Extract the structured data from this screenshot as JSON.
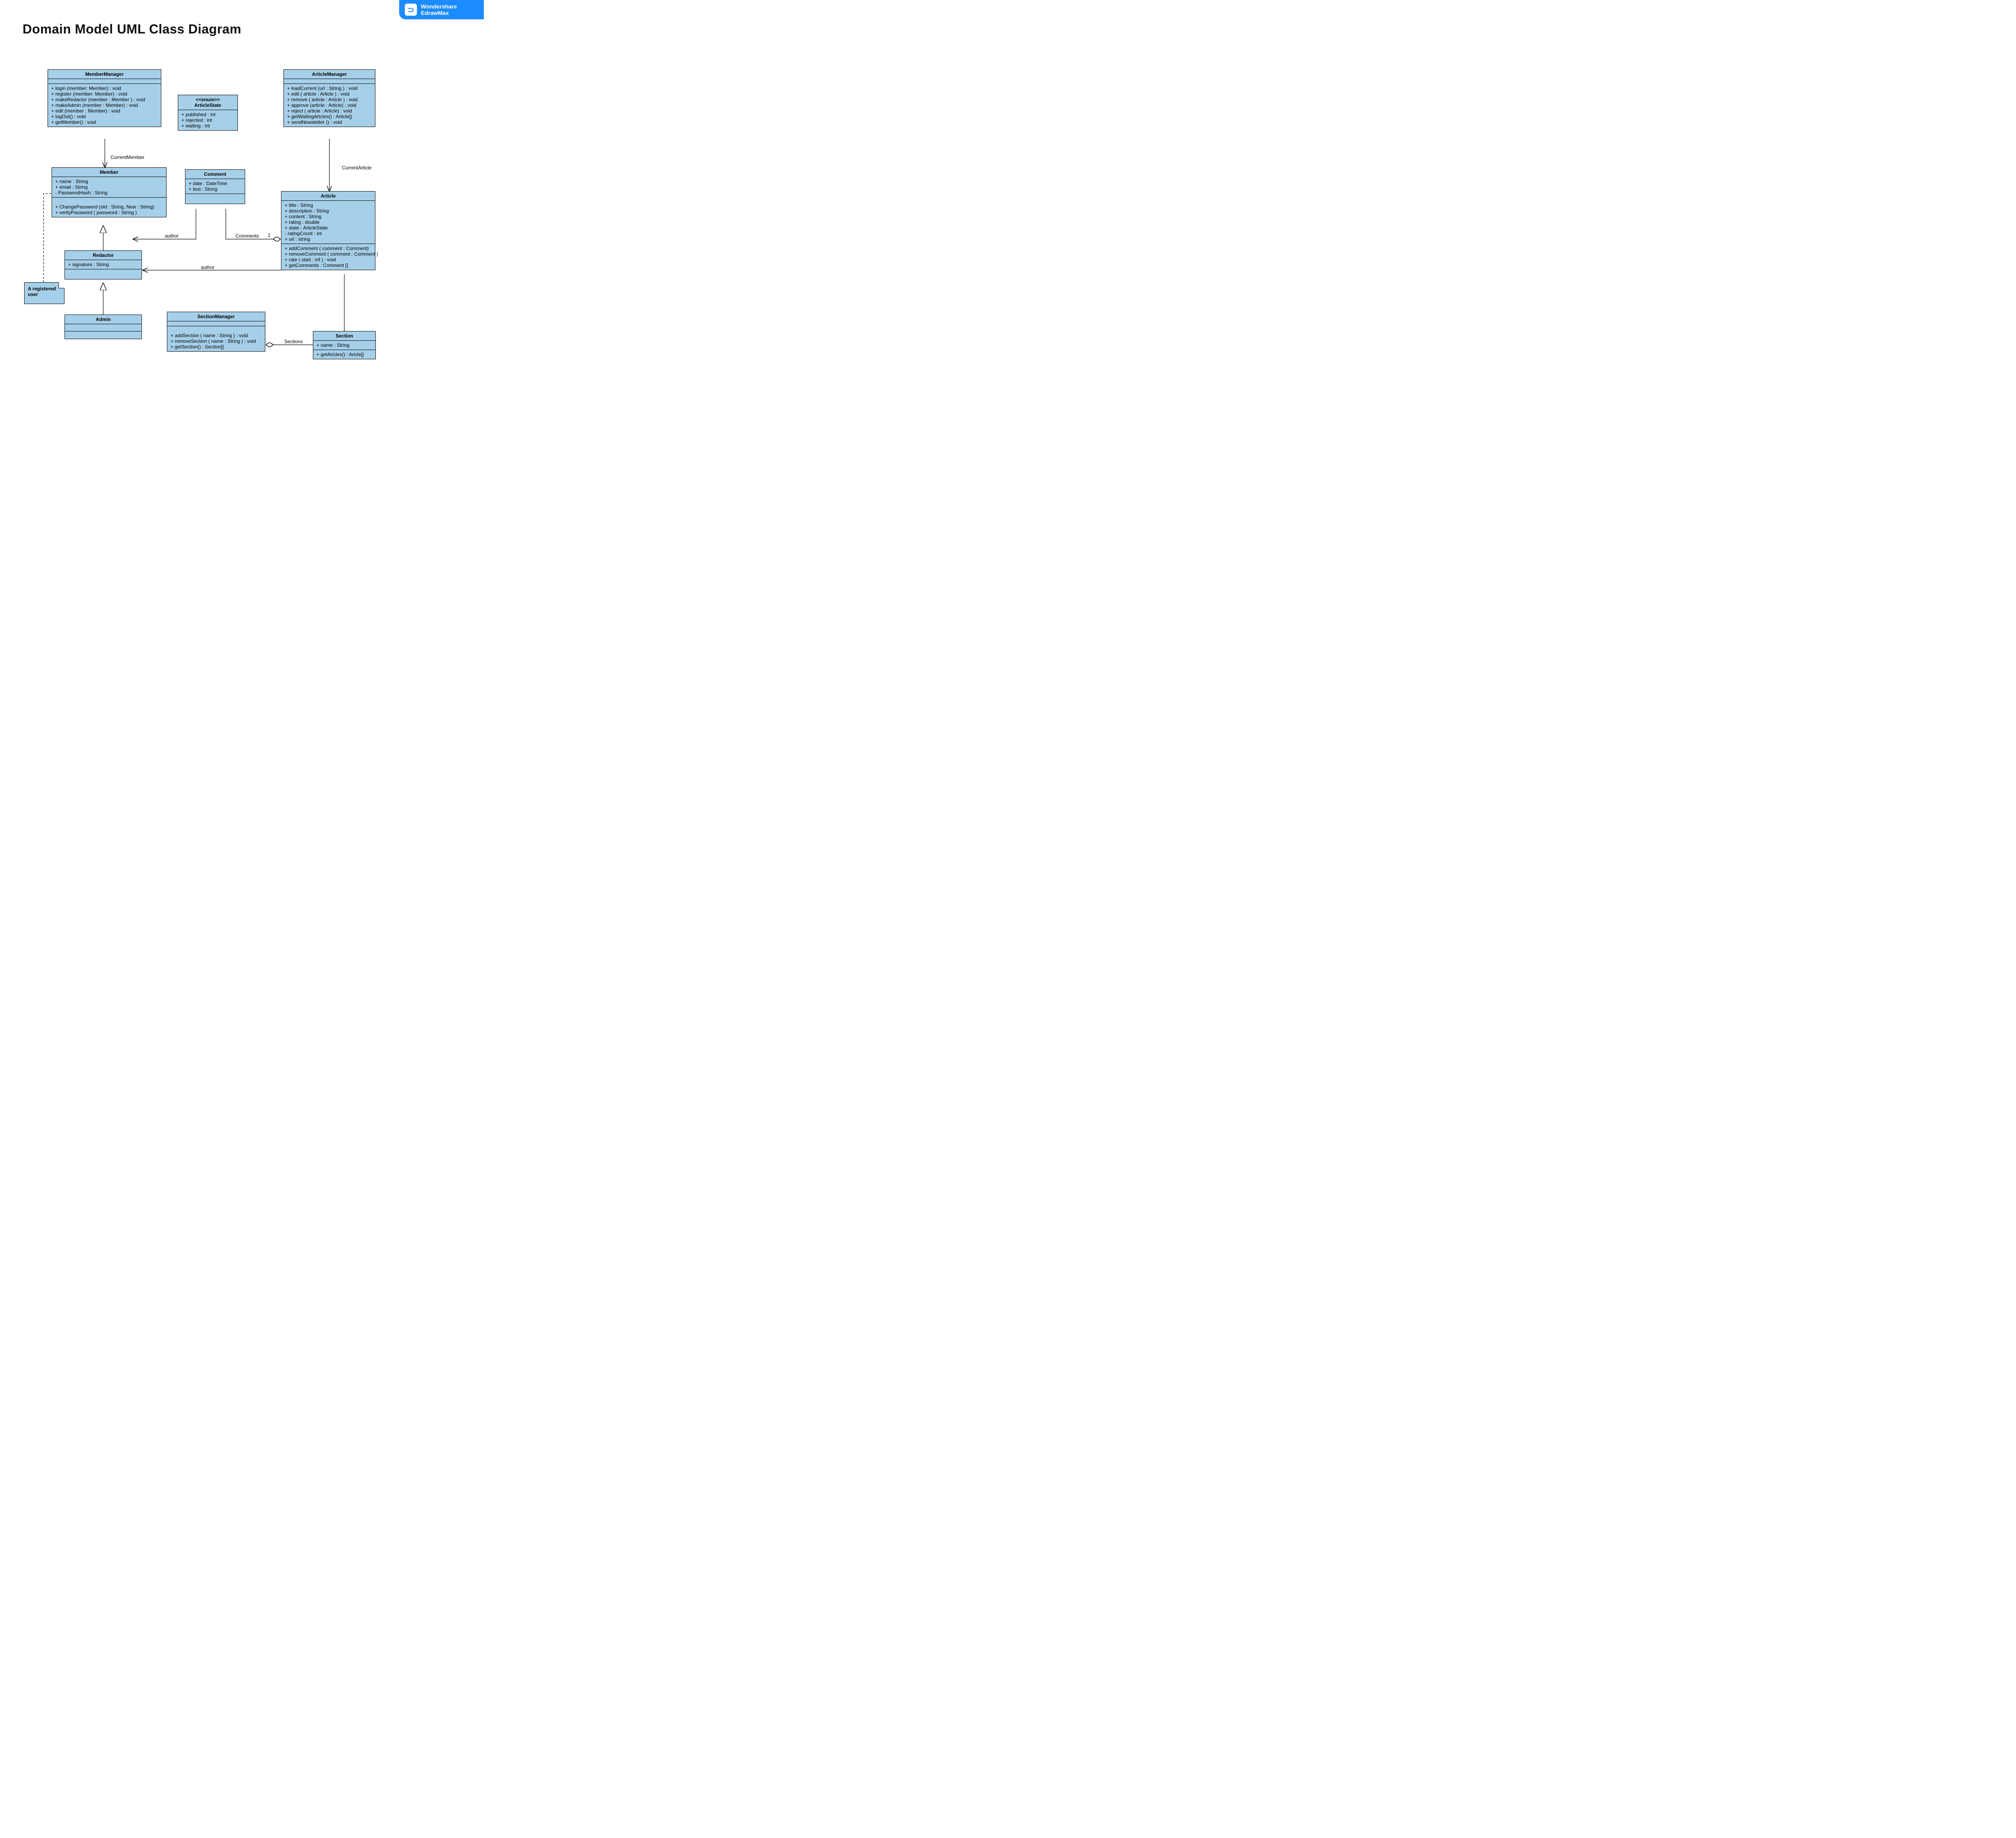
{
  "title": "Domain Model UML Class Diagram",
  "brand": {
    "line1": "Wondershare",
    "line2": "EdrawMax",
    "icon": "⊃"
  },
  "memberManager": {
    "name": "MemberManager",
    "ops": [
      "+  login (member: Member) : void",
      "+  register (member: Member) : void",
      "+ makeRedactor (member : Member ) : void",
      "+ makeAdmin (member : Member) : void",
      "+ edit (member : Member) : void",
      "+ logOut() : void",
      "+ getMember() : void"
    ]
  },
  "member": {
    "name": "Member",
    "attrs": [
      "+ name : String",
      "+ email : String",
      "- PasswordHash : String"
    ],
    "ops": [
      "+  ChangePassword (old : String, New : String)",
      "+  verityPassword ( password : String )"
    ]
  },
  "articleState": {
    "stereo": "<<enum>>",
    "name": "ArticleState",
    "attrs": [
      "+  published : int",
      "+  rejected : int",
      "+  waiting : int"
    ]
  },
  "articleManager": {
    "name": "ArticleManager",
    "ops": [
      "+ loadCurrent (url : String ) : void",
      "+ edit ( article : Article ) : void",
      "+ remove ( article : Article ) : void",
      "+ approve (article : Article) : void",
      "+ reject ( article : Article) : void",
      "+ getWaitingArtcles() : Article[]",
      "+ sendNewsletter () : void"
    ]
  },
  "comment": {
    "name": "Comment",
    "attrs": [
      "+  date : DateTime",
      "+  text : String"
    ]
  },
  "article": {
    "name": "Article",
    "attrs": [
      "+  title : String",
      "+  description : String",
      "+  content : String",
      "+  rating : double",
      "+  state : ArticleState",
      "-  ratingCount : int",
      "+  url : string"
    ],
    "ops": [
      "+ addComment ( comment : Comment)",
      "+ removeComment ( comment : Comment )",
      "+ rate ( start : inf ) : void",
      "+ getComments : Comment []"
    ]
  },
  "redactor": {
    "name": "Redactor",
    "attrs": [
      "+ signature : String"
    ]
  },
  "admin": {
    "name": "Admin"
  },
  "sectionManager": {
    "name": "SectionManager",
    "ops": [
      "+ addSection ( name : String ) : void",
      "+ removeSection ( name : String ) : void",
      "+ getSection() : Section[]"
    ]
  },
  "section": {
    "name": "Section",
    "attrs": [
      "+ name : String"
    ],
    "ops": [
      "+ getAricles() : Aricle[]"
    ]
  },
  "note": {
    "text": "A registered user"
  },
  "labels": {
    "currentMember": "CurrentMember",
    "currentArticle": "CurrentArticle",
    "author1": "author",
    "author2": "author",
    "comments": "Comments",
    "one": "1",
    "sections": "Sections"
  }
}
